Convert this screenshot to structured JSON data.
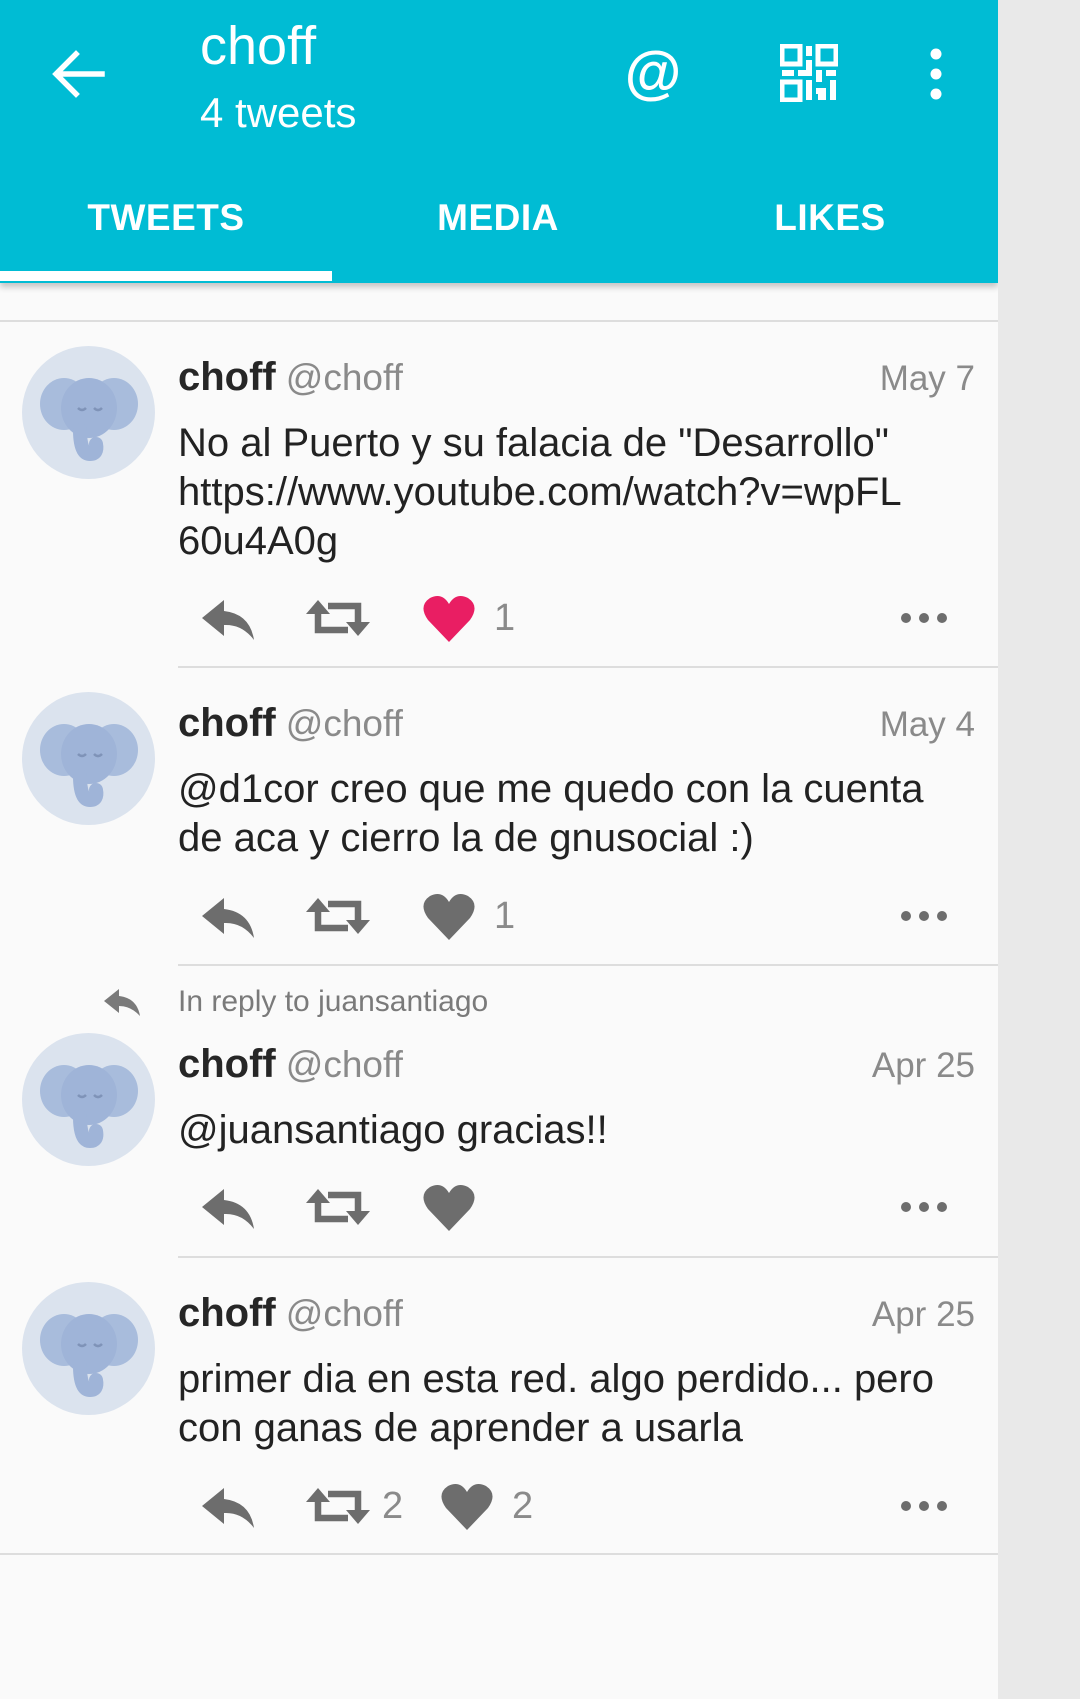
{
  "colors": {
    "accent": "#00bcd4",
    "like_active": "#e91e63",
    "icon_gray": "#6d6d6d",
    "text_secondary": "#8a8a8a"
  },
  "header": {
    "title": "choff",
    "subtitle": "4 tweets",
    "icons": [
      "back-arrow-icon",
      "at-sign-icon",
      "qr-code-icon",
      "more-vert-icon"
    ]
  },
  "tabs": [
    {
      "label": "TWEETS",
      "selected": true
    },
    {
      "label": "MEDIA",
      "selected": false
    },
    {
      "label": "LIKES",
      "selected": false
    }
  ],
  "tweets": [
    {
      "name": "choff",
      "handle": "@choff",
      "date": "May 7",
      "text": "No al Puerto y su falacia de \"Desarrollo\" https://www.youtube.com/watch?v=wpFL60u4A0g",
      "reply_context": "",
      "retweets": "",
      "likes": "1",
      "liked": true
    },
    {
      "name": "choff",
      "handle": "@choff",
      "date": "May 4",
      "text": "@d1cor creo que me quedo con la cuenta de aca y cierro la de gnusocial :)",
      "reply_context": "",
      "retweets": "",
      "likes": "1",
      "liked": false
    },
    {
      "name": "choff",
      "handle": "@choff",
      "date": "Apr 25",
      "text": "@juansantiago gracias!!",
      "reply_context": "In reply to juansantiago",
      "retweets": "",
      "likes": "",
      "liked": false
    },
    {
      "name": "choff",
      "handle": "@choff",
      "date": "Apr 25",
      "text": "primer dia en esta red. algo perdido... pero con ganas de aprender a usarla",
      "reply_context": "",
      "retweets": "2",
      "likes": "2",
      "liked": false
    }
  ]
}
